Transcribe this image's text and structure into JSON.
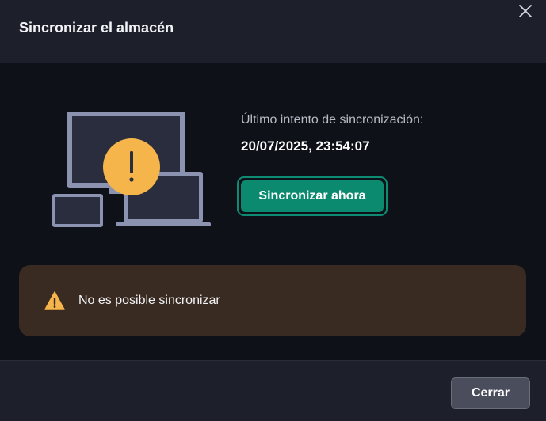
{
  "dialog": {
    "title": "Sincronizar el almacén",
    "close_icon": "close-icon"
  },
  "sync": {
    "last_attempt_label": "Último intento de sincronización:",
    "last_attempt_value": "20/07/2025, 23:54:07",
    "sync_button_label": "Sincronizar ahora",
    "illustration_icon": "devices-warning-icon"
  },
  "warning": {
    "icon": "warning-triangle-icon",
    "message": "No es posible sincronizar"
  },
  "footer": {
    "close_button_label": "Cerrar"
  },
  "colors": {
    "header_bg": "#1d1f2a",
    "body_bg": "#0f1118",
    "accent_green": "#0b8a70",
    "warning_bg": "#3a2b22",
    "warning_yellow": "#f6b54a"
  }
}
